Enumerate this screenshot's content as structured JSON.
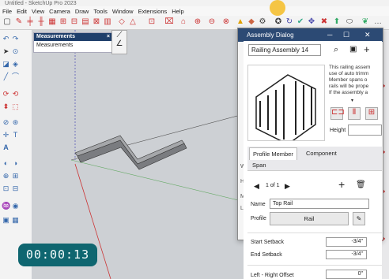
{
  "app": {
    "title": "Untitled - SketchUp Pro 2023"
  },
  "menu": [
    "File",
    "Edit",
    "View",
    "Camera",
    "Draw",
    "Tools",
    "Window",
    "Extensions",
    "Help"
  ],
  "measurements": {
    "title": "Measurements",
    "label": "Measurements",
    "close": "×"
  },
  "timer": {
    "value": "00:00:13"
  },
  "dialog": {
    "title": "Assembly Dialog",
    "assembly_name": "Railing Assembly 14",
    "description": [
      "This railing assem",
      "use of auto trimm",
      "Member spans o",
      "rails will be prope",
      "If the assembly a"
    ],
    "height_label": "Height",
    "tabs": [
      "Profile Member",
      "Component",
      "Span"
    ],
    "pager": "1 of 1",
    "name_label": "Name",
    "name_value": "Top Rail",
    "profile_label": "Profile",
    "profile_value": "Rail",
    "start_setback_label": "Start Setback",
    "start_setback_value": "-3/4\"",
    "end_setback_label": "End Setback",
    "end_setback_value": "-3/4\"",
    "lr_offset_label": "Left - Right Offset",
    "lr_offset_value": "0\"",
    "left_letters": [
      "W",
      "H",
      "M",
      "L"
    ]
  }
}
